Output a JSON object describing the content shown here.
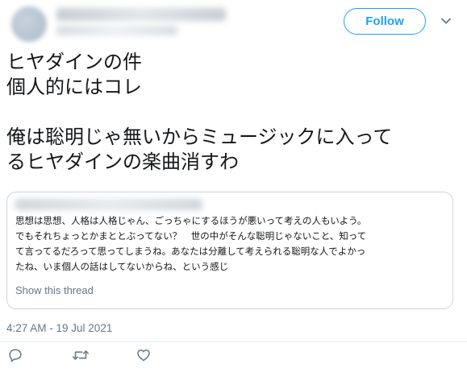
{
  "header": {
    "follow_label": "Follow"
  },
  "tweet": {
    "text": "ヒヤダインの件\n個人的にはコレ\n\n俺は聡明じゃ無いからミュージックに入って\nるヒヤダインの楽曲消すわ"
  },
  "quoted": {
    "text": "思想は思想、人格は人格じゃん、ごっちゃにするほうが悪いって考えの人もいよう。\nでもそれちょっとかまととぶってない？　世の中がそんな聡明じゃないこと、知って\nて言ってるだろって思ってしまうね。あなたは分離して考えられる聡明な人でよかっ\nたね、いま個人の話はしてないからね、という感じ",
    "show_thread_label": "Show this thread"
  },
  "meta": {
    "timestamp": "4:27 AM - 19 Jul 2021"
  },
  "actions": {
    "reply_icon": "reply-icon",
    "retweet_icon": "retweet-icon",
    "like_icon": "like-icon"
  },
  "colors": {
    "accent": "#1da1f2",
    "secondary_text": "#657786",
    "border": "#ccd6dd"
  }
}
